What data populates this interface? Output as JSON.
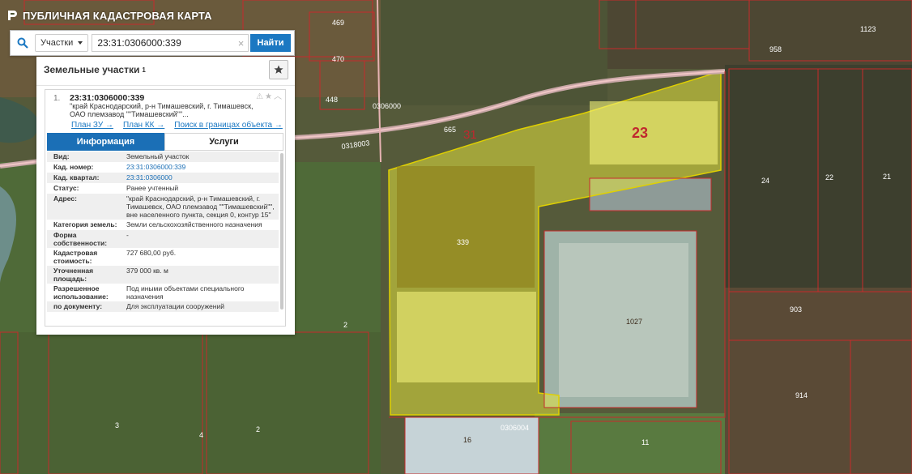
{
  "app": {
    "title": "ПУБЛИЧНАЯ КАДАСТРОВАЯ КАРТА"
  },
  "search": {
    "type_label": "Участки",
    "query": "23:31:0306000:339",
    "find_label": "Найти",
    "clear_glyph": "×"
  },
  "panel": {
    "title": "Земельные участки",
    "count": "1",
    "star_icon": "star-icon",
    "result": {
      "num": "1.",
      "cad_number": "23:31:0306000:339",
      "address_short": "\"край Краснодарский, р-н Тимашевский, г. Тимашевск, ОАО племзавод \"\"Тимашевский\"\"...",
      "links": {
        "plan_zu": "План ЗУ →",
        "plan_kk": "План КК →",
        "search_bounds": "Поиск в границах объекта →"
      },
      "tabs": {
        "info": "Информация",
        "services": "Услуги"
      },
      "rows": [
        {
          "k": "Вид:",
          "v": "Земельный участок"
        },
        {
          "k": "Кад. номер:",
          "v": "23:31:0306000:339"
        },
        {
          "k": "Кад. квартал:",
          "v": "23:31:0306000"
        },
        {
          "k": "Статус:",
          "v": "Ранее учтенный"
        },
        {
          "k": "Адрес:",
          "v": "\"край Краснодарский, р-н Тимашевский, г. Тимашевск, ОАО племзавод \"\"Тимашевский\"\", вне населенного пункта, секция 0, контур 15\""
        },
        {
          "k": "Категория земель:",
          "v": "Земли сельскохозяйственного назначения"
        },
        {
          "k": "Форма собственности:",
          "v": "-"
        },
        {
          "k": "Кадастровая стоимость:",
          "v": "727 680,00 руб."
        },
        {
          "k": "Уточненная площадь:",
          "v": "379 000 кв. м"
        },
        {
          "k": "Разрешенное использование:",
          "v": "Под иными объектами специального назначения"
        },
        {
          "k": "по документу:",
          "v": "Для эксплуатации сооружений"
        }
      ]
    }
  },
  "map": {
    "labels": {
      "q_0306000": "0306000",
      "q_0318003": "0318003",
      "q_0306004": "0306004",
      "d31": "31",
      "d23": "23",
      "p339": "339",
      "p1027": "1027",
      "p665": "665",
      "p469": "469",
      "p470": "470",
      "p448": "448",
      "p958": "958",
      "p1123": "1123",
      "p24": "24",
      "p22": "22",
      "p21": "21",
      "p903": "903",
      "p914": "914",
      "p16": "16",
      "p11": "11",
      "p2a": "2",
      "p2b": "2",
      "p3": "3",
      "p4": "4"
    },
    "colors": {
      "selected_fill": "#e2e23c",
      "boundary": "#c62b2b",
      "accent": "#1b78c2"
    }
  }
}
